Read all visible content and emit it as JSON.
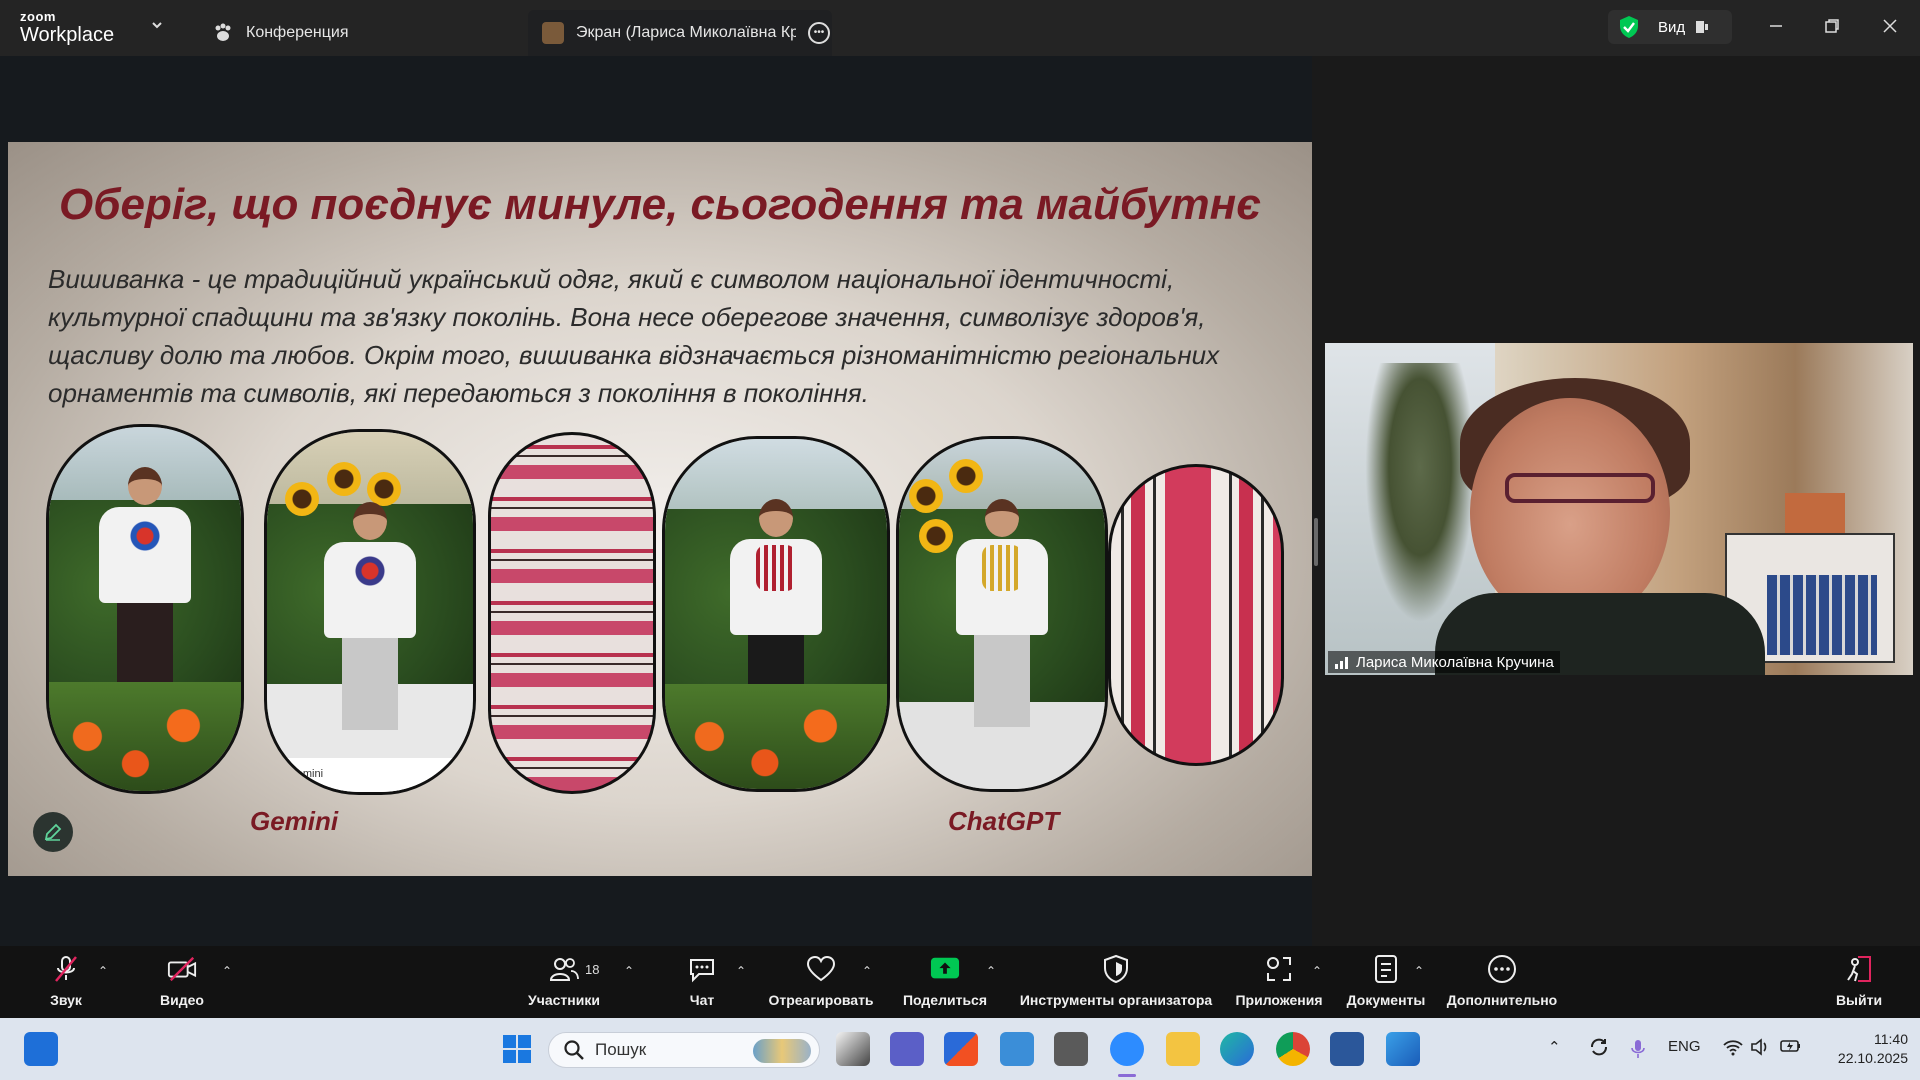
{
  "window": {
    "brand_small": "zoom",
    "brand_big": "Workplace",
    "tabs": [
      {
        "label": "Конференция"
      },
      {
        "label": "Экран (Лариса Миколаївна Кру"
      }
    ],
    "view_label": "Вид"
  },
  "slide": {
    "title": "Оберіг, що поєднує минуле, сьогодення та майбутнє",
    "body": "Вишиванка - це традиційний український одяг, який є символом національної ідентичності, культурної спадщини та зв'язку поколінь. Вона несе оберегове значення, символізує здоров'я, щасливу долю та любов. Окрім того, вишиванка відзначається різноманітністю регіональних орнаментів та символів, які передаються з покоління в покоління.",
    "photo_watermark": "e Gemini",
    "captions": [
      "Gemini",
      "ChatGPT"
    ]
  },
  "participant": {
    "name": "Лариса Миколаївна Кручина"
  },
  "toolbar": {
    "audio": "Звук",
    "video": "Видео",
    "participants": "Участники",
    "participants_count": "18",
    "chat": "Чат",
    "react": "Отреагировать",
    "share": "Поделиться",
    "host_tools": "Инструменты организатора",
    "apps": "Приложения",
    "docs": "Документы",
    "more": "Дополнительно",
    "leave": "Выйти"
  },
  "taskbar": {
    "search_placeholder": "Пошук",
    "lang": "ENG",
    "time": "11:40",
    "date": "22.10.2025"
  },
  "colors": {
    "accent_red": "#7a1a24",
    "zoom_green": "#00c853",
    "leave_red": "#e0245e"
  }
}
